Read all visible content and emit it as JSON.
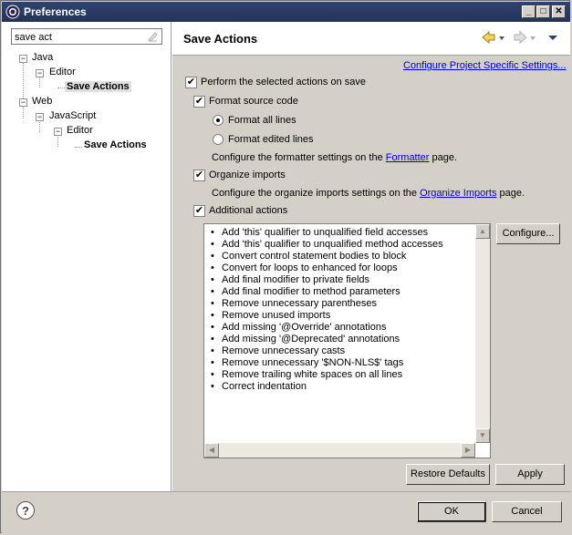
{
  "window": {
    "title": "Preferences"
  },
  "filter": {
    "value": "save act"
  },
  "tree": {
    "java": "Java",
    "java_editor": "Editor",
    "java_save_actions": "Save Actions",
    "web": "Web",
    "javascript": "JavaScript",
    "js_editor": "Editor",
    "js_save_actions": "Save Actions"
  },
  "page": {
    "title": "Save Actions",
    "project_link": "Configure Project Specific Settings...",
    "perform_label": "Perform the selected actions on save",
    "format_label": "Format source code",
    "format_all": "Format all lines",
    "format_edited": "Format edited lines",
    "formatter_prefix": "Configure the formatter settings on the ",
    "formatter_link": "Formatter",
    "formatter_suffix": " page.",
    "organize_label": "Organize imports",
    "organize_prefix": "Configure the organize imports settings on the ",
    "organize_link": "Organize Imports",
    "organize_suffix": " page.",
    "additional_label": "Additional actions",
    "configure_button": "Configure...",
    "actions": [
      "Add 'this' qualifier to unqualified field accesses",
      "Add 'this' qualifier to unqualified method accesses",
      "Convert control statement bodies to block",
      "Convert for loops to enhanced for loops",
      "Add final modifier to private fields",
      "Add final modifier to method parameters",
      "Remove unnecessary parentheses",
      "Remove unused imports",
      "Add missing '@Override' annotations",
      "Add missing '@Deprecated' annotations",
      "Remove unnecessary casts",
      "Remove unnecessary '$NON-NLS$' tags",
      "Remove trailing white spaces on all lines",
      "Correct indentation"
    ],
    "restore_button": "Restore Defaults",
    "apply_button": "Apply"
  },
  "footer": {
    "ok_button": "OK",
    "cancel_button": "Cancel"
  },
  "state": {
    "perform_checked": true,
    "format_checked": true,
    "format_mode": "all",
    "organize_checked": true,
    "additional_checked": true
  },
  "colors": {
    "titlebar": "#243458",
    "link": "#0000cc",
    "dialog_bg": "#d4d0c8"
  }
}
